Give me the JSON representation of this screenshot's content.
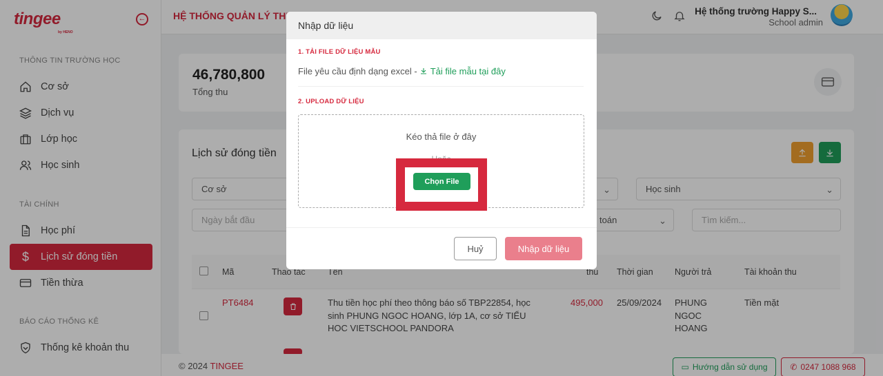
{
  "brand": {
    "name": "tingee",
    "sub": "by HENO"
  },
  "header": {
    "title": "HỆ THỐNG QUẢN LÝ THU",
    "school_name": "Hệ thống trường Happy S...",
    "school_role": "School admin"
  },
  "sidebar": {
    "sections": [
      {
        "title": "THÔNG TIN TRƯỜNG HỌC"
      },
      {
        "title": "TÀI CHÍNH"
      },
      {
        "title": "BÁO CÁO THỐNG KÊ"
      }
    ],
    "items": [
      {
        "label": "Cơ sở",
        "icon": "home-icon"
      },
      {
        "label": "Dịch vụ",
        "icon": "layers-icon"
      },
      {
        "label": "Lớp học",
        "icon": "briefcase-icon"
      },
      {
        "label": "Học sinh",
        "icon": "users-icon"
      },
      {
        "label": "Học phí",
        "icon": "document-icon"
      },
      {
        "label": "Lịch sử đóng tiền",
        "icon": "dollar-icon",
        "active": true
      },
      {
        "label": "Tiền thừa",
        "icon": "card-icon"
      },
      {
        "label": "Thống kê khoản thu",
        "icon": "shield-icon"
      }
    ]
  },
  "stats": {
    "value": "46,780,800",
    "label": "Tổng thu"
  },
  "history": {
    "title": "Lịch sử đóng tiền",
    "filters": {
      "facility": "Cơ sở",
      "student": "Học sinh",
      "start_date": "Ngày bắt đầu",
      "account": "toán",
      "search": "Tìm kiếm..."
    },
    "columns": [
      "Mã",
      "Thao tác",
      "Tên",
      "thu",
      "Thời gian",
      "Người trả",
      "Tài khoản thu"
    ],
    "rows": [
      {
        "code": "PT6484",
        "name": "Thu tiền học phí theo thông báo số TBP22854, học sinh PHUNG NGOC HOANG, lớp 1A, cơ sở TIỂU HOC VIETSCHOOL PANDORA",
        "amount": "495,000",
        "time": "25/09/2024",
        "payer": "PHUNG NGOC HOANG",
        "account": "Tiền mặt"
      }
    ]
  },
  "footer": {
    "copyright": "© 2024",
    "brand": "TINGEE",
    "guide": "Hướng dẫn sử dụng",
    "phone": "0247 1088 968"
  },
  "modal": {
    "title": "Nhập dữ liệu",
    "step1": "1. TẢI FILE DỮ LIỆU MẪU",
    "requirement": "File yêu cầu định dạng excel -",
    "download_link": "Tải file mẫu tại đây",
    "step2": "2. UPLOAD DỮ LIỆU",
    "drop_text": "Kéo thả file ở đây",
    "or_text": "Hoặc",
    "choose_button": "Chọn File",
    "cancel": "Huỷ",
    "submit": "Nhập dữ liệu"
  },
  "colors": {
    "brand": "#d6293e",
    "success": "#1f9e5a",
    "warning": "#f0a030",
    "submit_disabled": "#ea7f8c"
  }
}
